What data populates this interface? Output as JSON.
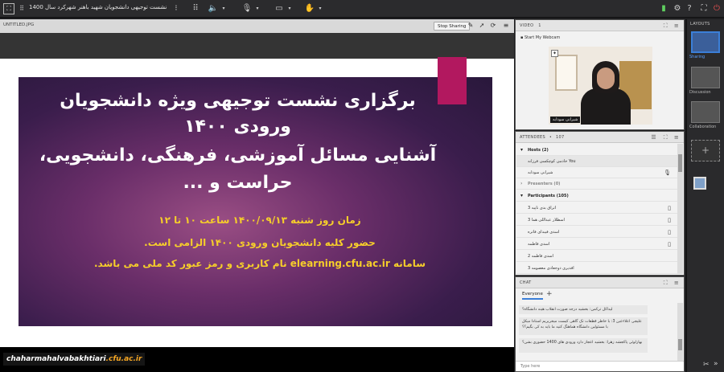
{
  "window": {
    "title": "نشست توجیهی دانشجویان شهید باهنر شهرکرد سال 1400"
  },
  "share": {
    "pod_name": "UNTITLED.JPG",
    "stop_label": "Stop Sharing",
    "slide": {
      "heading_lines": [
        "برگزاری نشست توجیهی ویژه دانشجویان",
        "ورودی ۱۴۰۰",
        "آشنایی مسائل آموزشی، فرهنگی، دانشجویی،",
        "حراست و ..."
      ],
      "info_lines": [
        "زمان روز شنبه ۱۴۰۰/۰۹/۱۳ ساعت ۱۰ تا ۱۲",
        "حضور کلیه دانشجویان ورودی ۱۴۰۰ الزامی است.",
        "سامانه elearning.cfu.ac.ir نام کاربری و رمز عبور کد ملی می باشد."
      ]
    },
    "watermark": {
      "name": "chaharmahalvabakhtiari",
      "domain": ".cfu.ac.ir"
    }
  },
  "video": {
    "title": "VIDEO",
    "count": "1",
    "start_label": "Start My Webcam",
    "participant_name": "شیرانی سودابه"
  },
  "attendees": {
    "title": "ATTENDEES",
    "count": "107",
    "hosts_label": "Hosts (2)",
    "host1": "You خادمی کوچکسی فرزانه",
    "host2": "شیرانی سودابه",
    "presenters_label": "Presenters (0)",
    "participants_label": "Participants (105)",
    "participants": [
      "اتراق بدی ناپیه 3",
      "اسطلار عبداللی هما 3",
      "اسدی فیبدای فاتره",
      "اسدی فاطمه",
      "اسدی فاطمه 2",
      "افدیری دوجعادی معصومه 3"
    ]
  },
  "chat": {
    "title": "CHAT",
    "tab_everyone": "Everyone",
    "messages": [
      "لیداکل ترکمن: بخشید درجه صورت انقلاب هینه دانشگاه؟",
      "علیجی اعلاءعین 3: با خاطر قطعات تک گاهی کیست میخریریم استادا میکل با مسئولین دانشگاه هماهنگ کنید ما باید به کی بگیم؟؟",
      "بهارلوئی پاکجشه زهرا: بخشید اعجاز دارد ورودی های 1400 حضوری بشن؟"
    ],
    "type_placeholder": "Type here"
  },
  "layouts": {
    "title": "LAYOUTS",
    "items": [
      "Sharing",
      "Discussion",
      "Collaboration"
    ],
    "add_symbol": "+"
  },
  "icons": {
    "screen": "⛶",
    "grid": "⁝⁝⁝",
    "mic": "🎙",
    "speaker": "🔊",
    "camera": "📷",
    "hand": "✋",
    "chevron": "▾"
  }
}
